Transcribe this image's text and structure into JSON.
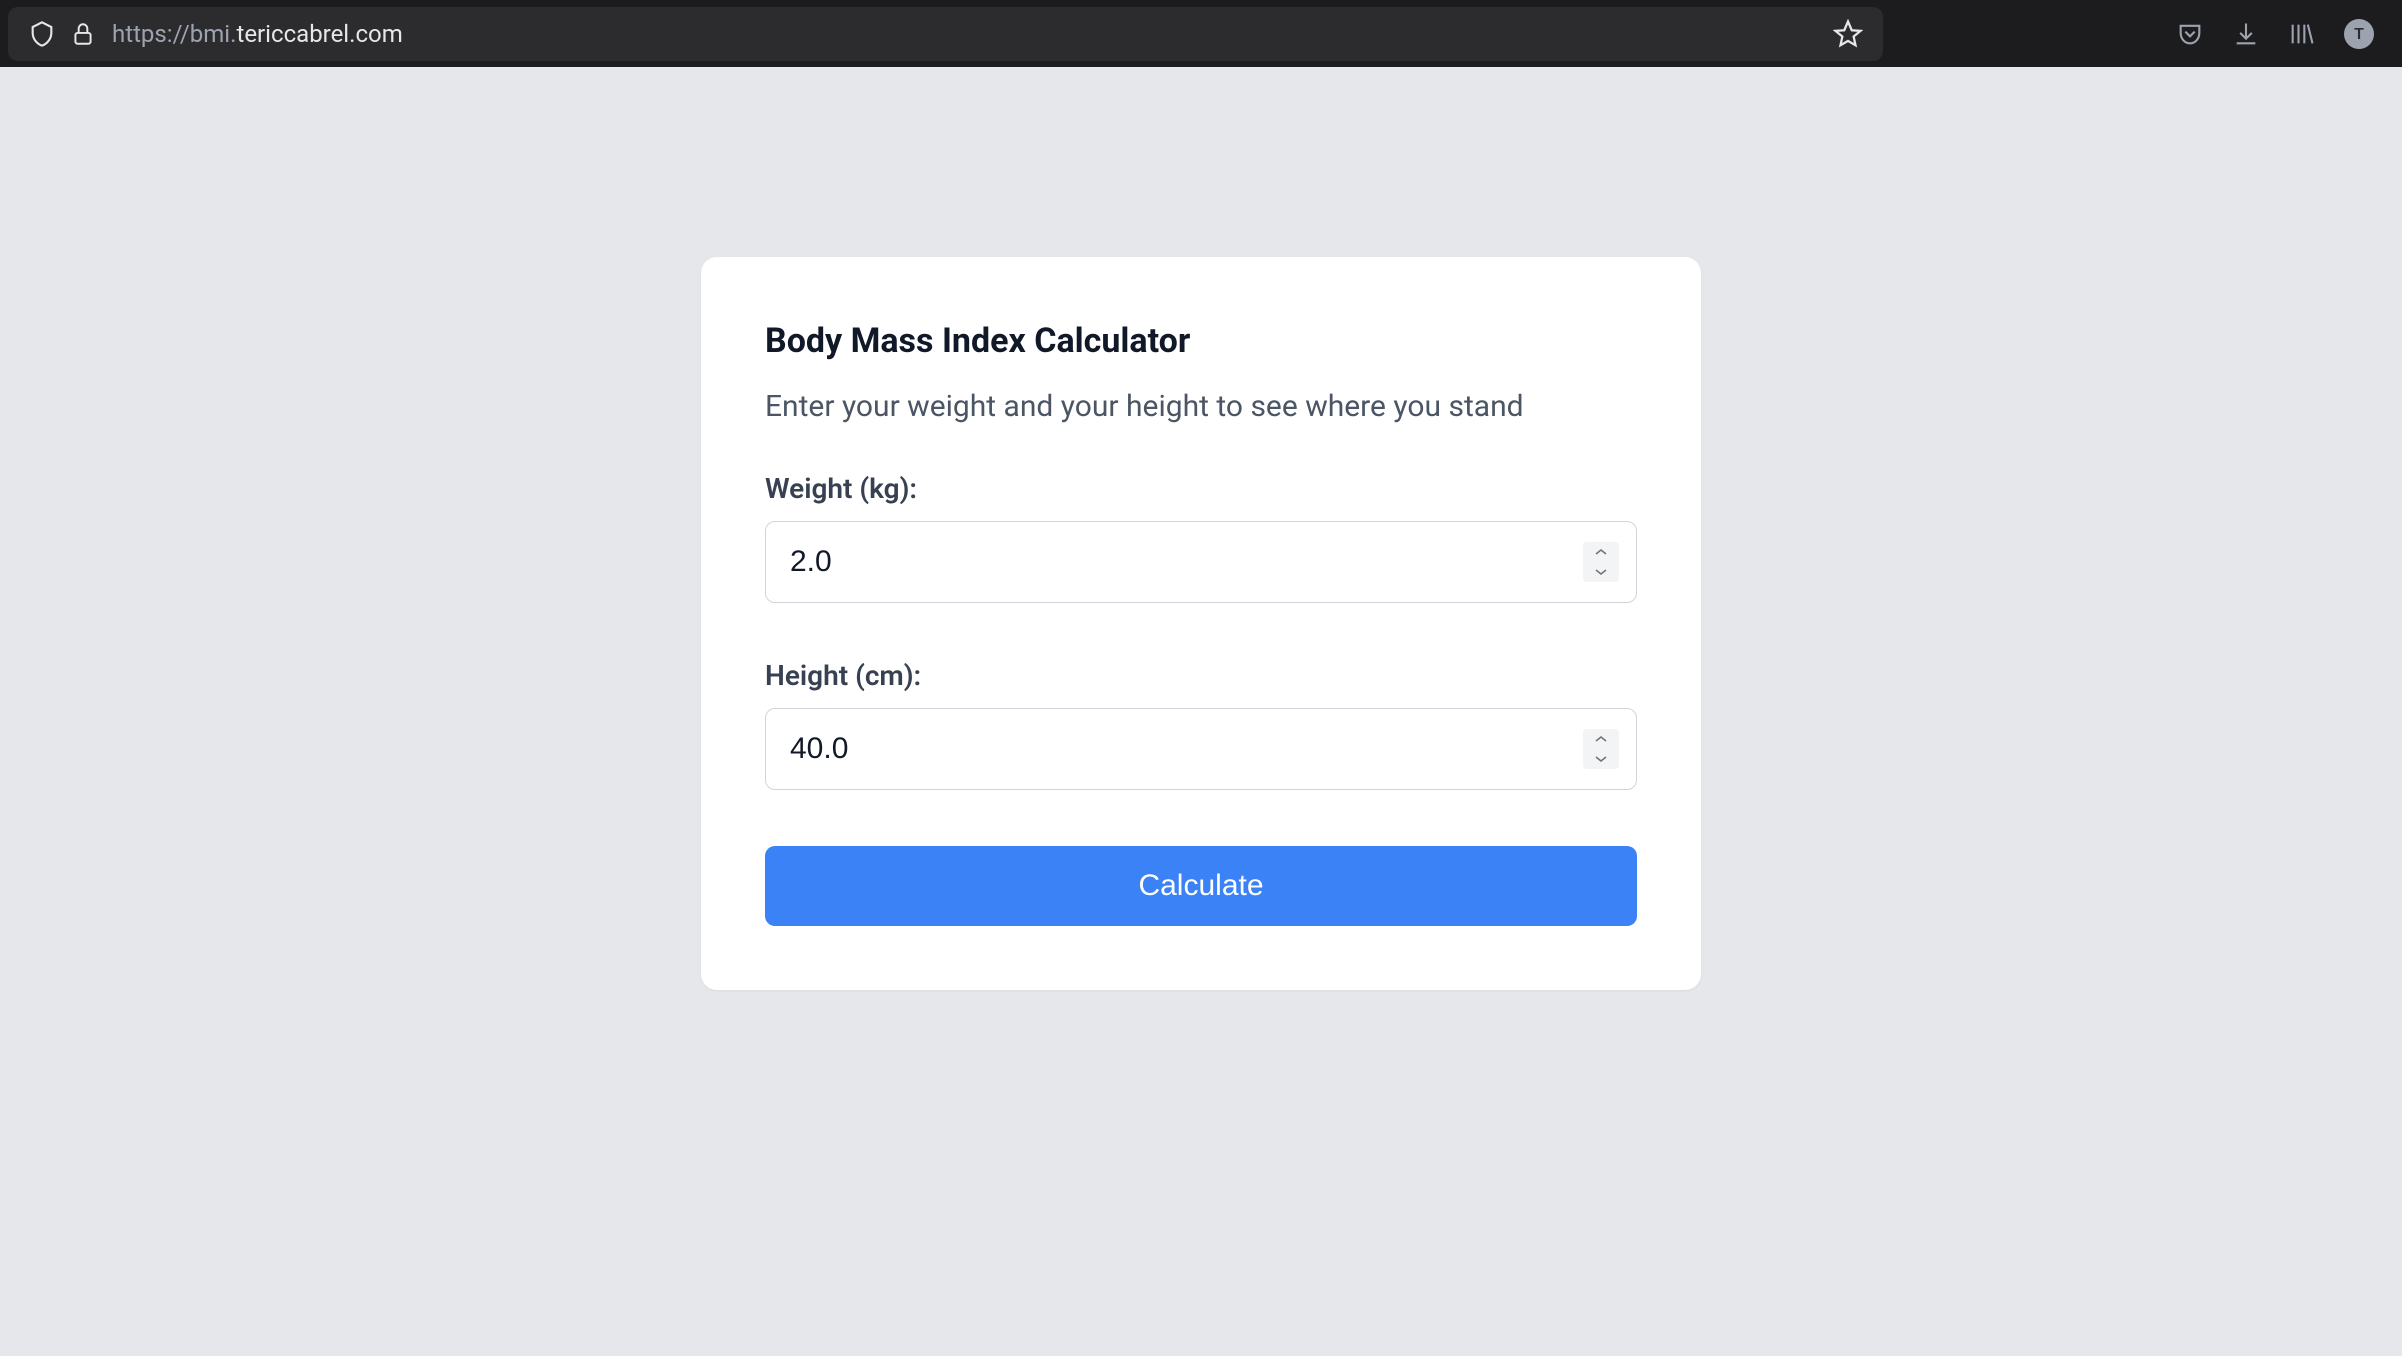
{
  "browser": {
    "url_prefix": "https://bmi.",
    "url_domain": "tericcabrel.com",
    "avatar_letter": "T"
  },
  "card": {
    "title": "Body Mass Index Calculator",
    "subtitle": "Enter your weight and your height to see where you stand"
  },
  "form": {
    "weight": {
      "label": "Weight (kg):",
      "value": "2.0"
    },
    "height": {
      "label": "Height (cm):",
      "value": "40.0"
    },
    "submit_label": "Calculate"
  }
}
